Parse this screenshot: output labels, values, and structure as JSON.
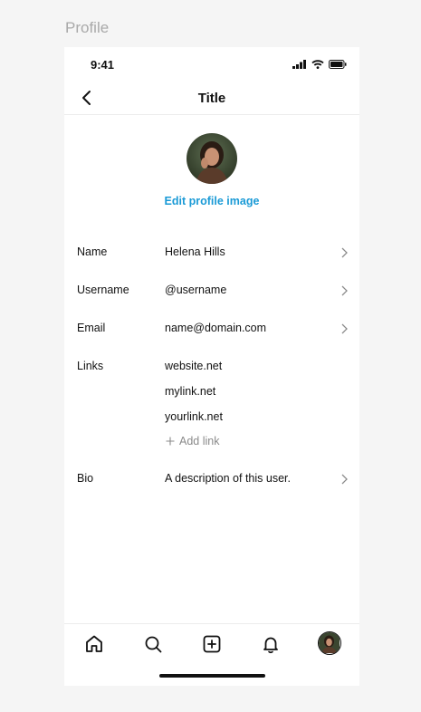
{
  "frame_label": "Profile",
  "status": {
    "time": "9:41"
  },
  "nav": {
    "title": "Title"
  },
  "profile": {
    "edit_image_label": "Edit profile image"
  },
  "fields": {
    "name": {
      "label": "Name",
      "value": "Helena Hills"
    },
    "username": {
      "label": "Username",
      "value": "@username"
    },
    "email": {
      "label": "Email",
      "value": "name@domain.com"
    },
    "links": {
      "label": "Links",
      "items": [
        "website.net",
        "mylink.net",
        "yourlink.net"
      ],
      "add_label": "Add link"
    },
    "bio": {
      "label": "Bio",
      "value": "A description of this user."
    }
  },
  "tab_bar": {
    "tabs": [
      "home-icon",
      "search-icon",
      "add-icon",
      "bell-icon",
      "avatar"
    ]
  },
  "colors": {
    "accent": "#1a9ad6",
    "muted": "#8a8a8a",
    "background": "#f5f5f5"
  }
}
